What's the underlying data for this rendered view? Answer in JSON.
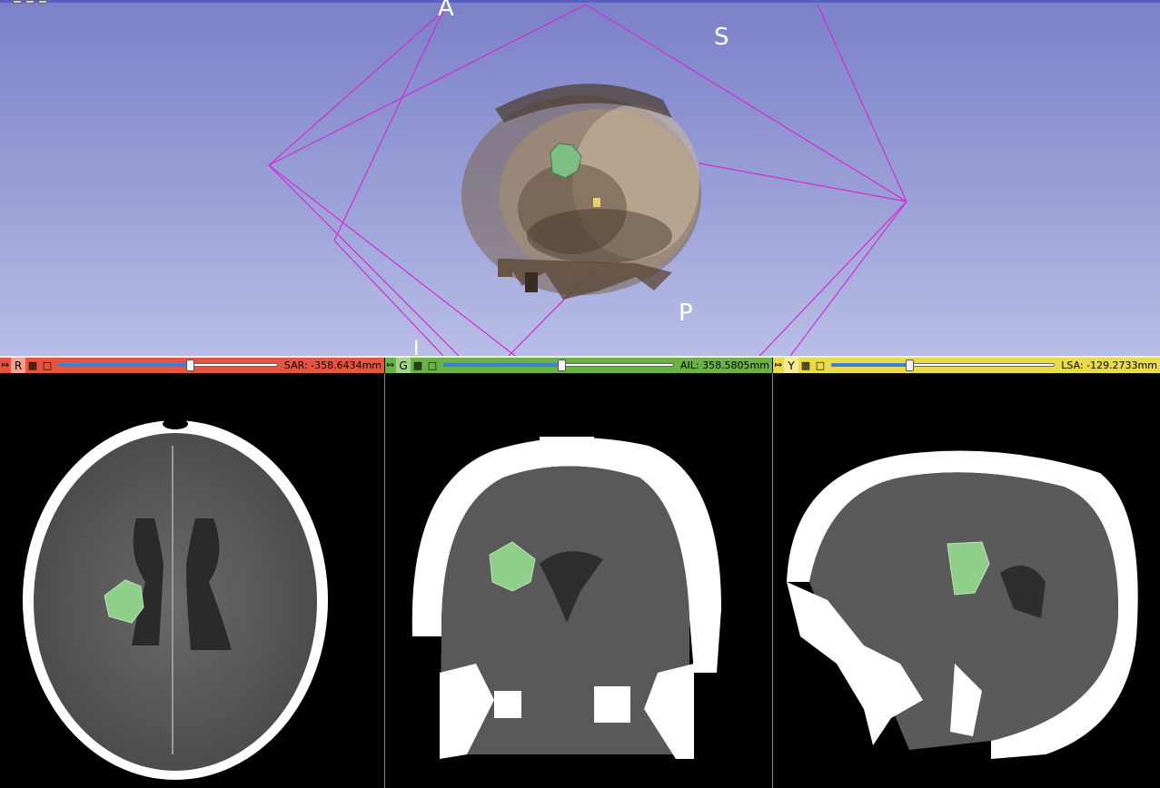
{
  "view3d": {
    "orientation_labels": {
      "anterior": "A",
      "superior": "S",
      "posterior": "P",
      "lower": "I"
    },
    "colors": {
      "box": "#d42ad4",
      "background_top": "#7b80c8",
      "background_bottom": "#b8bde6"
    }
  },
  "slice_views": {
    "red": {
      "letter": "R",
      "readout": "SAR: -358.6434mm",
      "slider_fraction": 0.6,
      "color": "#e4543f"
    },
    "green": {
      "letter": "G",
      "readout": "AIL: 358.5805mm",
      "slider_fraction": 0.51,
      "color": "#69b247"
    },
    "yellow": {
      "letter": "Y",
      "readout": "LSA: -129.2733mm",
      "slider_fraction": 0.35,
      "color": "#ead948"
    }
  },
  "icons": {
    "pin": "pin-icon",
    "link": "link-icon",
    "maximize": "maximize-icon"
  },
  "segment_color": "#8fcf8a"
}
